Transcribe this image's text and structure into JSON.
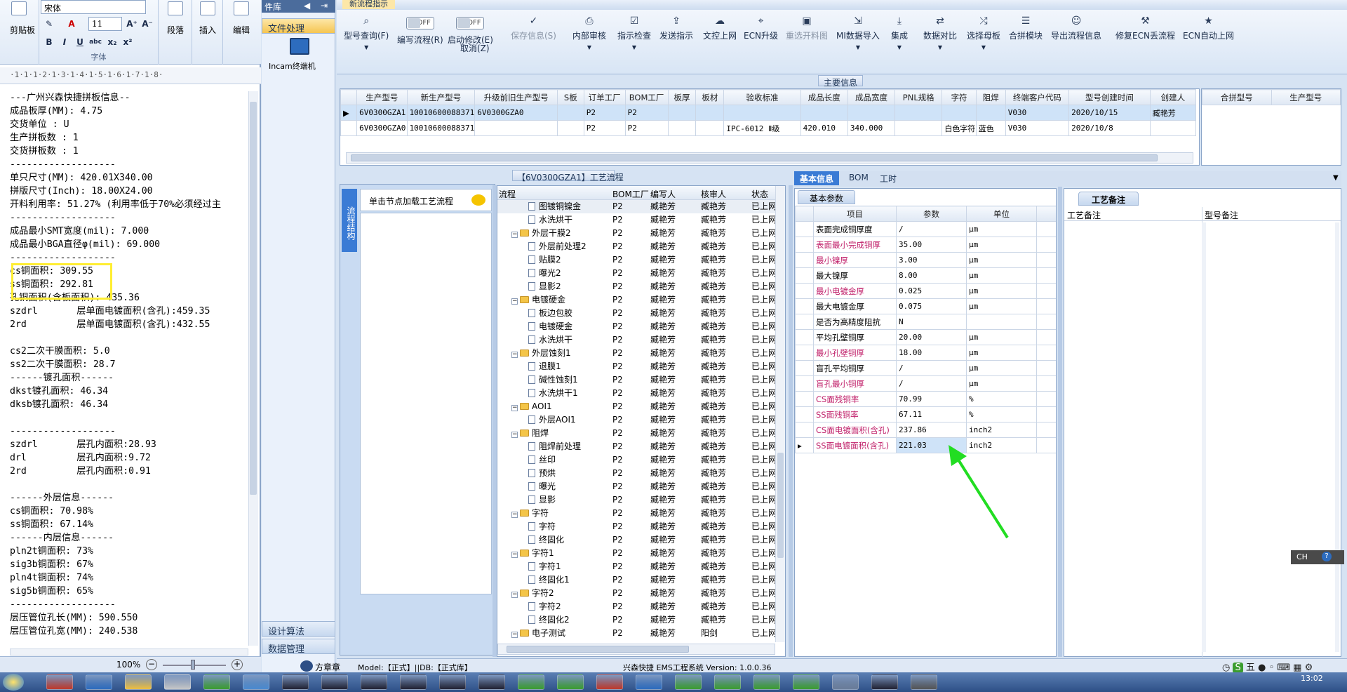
{
  "wordpad": {
    "clipboard_label": "剪贴板",
    "font_name": "宋体",
    "font_size": "11",
    "font_group_label": "字体",
    "paragraph_label": "段落",
    "insert_label": "插入",
    "edit_label": "编辑",
    "ruler": "·1·1·1·2·1·3·1·4·1·5·1·6·1·7·1·8·",
    "zoom": "100%",
    "lines": [
      "---广州兴森快捷拼板信息--",
      "成品板厚(MM): 4.75",
      "交货单位 : U",
      "生产拼板数 : 1",
      "交货拼板数 : 1",
      "-------------------",
      "单只尺寸(MM): 420.01X340.00",
      "拼版尺寸(Inch): 18.00X24.00",
      "开料利用率: 51.27% (利用率低于70%必须经过主",
      "-------------------",
      "成品最小SMT宽度(mil): 7.000",
      "成品最小BGA直径φ(mil): 69.000",
      "-------------------",
      "cs铜面积: 309.55",
      "ss铜面积: 292.81",
      "孔铜面积(含板面积): 435.36",
      "szdrl       层单面电镀面积(含孔):459.35",
      "2rd         层单面电镀面积(含孔):432.55",
      "",
      "cs2二次干膜面积: 5.0",
      "ss2二次干膜面积: 28.7",
      "------镀孔面积------",
      "dkst镀孔面积: 46.34",
      "dksb镀孔面积: 46.34",
      "",
      "-------------------",
      "szdrl       层孔内面积:28.93",
      "drl         层孔内面积:9.72",
      "2rd         层孔内面积:0.91",
      "",
      "------外层信息------",
      "cs铜面积: 70.98%",
      "ss铜面积: 67.14%",
      "------内层信息------",
      "pln2t铜面积: 73%",
      "sig3b铜面积: 67%",
      "pln4t铜面积: 74%",
      "sig5b铜面积: 65%",
      "-------------------",
      "层压管位孔长(MM): 590.550",
      "层压管位孔宽(MM): 240.538"
    ]
  },
  "nav": {
    "top_label": "件库",
    "file_process": "文件处理",
    "incam_label": "Incam终端机",
    "design_calc": "设计算法",
    "data_mgmt": "数据管理"
  },
  "main": {
    "window_title": "新流程指示",
    "toolbar": [
      {
        "label": "型号查询(F)",
        "icon": "search-icon"
      },
      {
        "label": "编写流程(R)",
        "icon": "toggle"
      },
      {
        "label": "启动修改(E)",
        "icon": "toggle"
      },
      {
        "label": "取消(Z)",
        "icon": ""
      },
      {
        "label": "保存信息(S)",
        "icon": "check-icon"
      },
      {
        "label": "内部审核",
        "icon": "print-icon"
      },
      {
        "label": "指示检查",
        "icon": "check-box-icon"
      },
      {
        "label": "发送指示",
        "icon": "upload-icon"
      },
      {
        "label": "文控上网",
        "icon": "cloud-icon"
      },
      {
        "label": "ECN升级",
        "icon": "binoculars-icon"
      },
      {
        "label": "重选开料图",
        "icon": "image-icon"
      },
      {
        "label": "MI数据导入",
        "icon": "import-icon"
      },
      {
        "label": "集成",
        "icon": "download-icon"
      },
      {
        "label": "数据对比",
        "icon": "compare-icon"
      },
      {
        "label": "选择母板",
        "icon": "shuffle-icon"
      },
      {
        "label": "合拼模块",
        "icon": "list-icon"
      },
      {
        "label": "导出流程信息",
        "icon": "smile-icon"
      },
      {
        "label": "修复ECN丢流程",
        "icon": "wrench-icon"
      },
      {
        "label": "ECN自动上网",
        "icon": "star-icon"
      }
    ],
    "toggle_off": "OFF",
    "main_info_title": "主要信息",
    "main_table": {
      "headers": [
        "生产型号",
        "新生产型号",
        "升级前旧生产型号",
        "S板",
        "订单工厂",
        "BOM工厂",
        "板厚",
        "板材",
        "验收标准",
        "成品长度",
        "成品宽度",
        "PNL规格",
        "字符",
        "阻焊",
        "终端客户代码",
        "型号创建时间",
        "创建人"
      ],
      "rows": [
        [
          "6V0300GZA1",
          "10010600088371",
          "6V0300GZA0",
          "",
          "P2",
          "P2",
          "",
          "",
          "",
          "",
          "",
          "",
          "",
          "",
          "V030",
          "2020/10/15",
          "臧艳芳"
        ],
        [
          "6V0300GZA0",
          "10010600088371",
          "",
          "",
          "P2",
          "P2",
          "",
          "",
          "IPC-6012 Ⅱ级",
          "420.010",
          "340.000",
          "",
          "白色字符",
          "蓝色",
          "V030",
          "2020/10/8",
          ""
        ]
      ]
    },
    "right_table_headers": [
      "合拼型号",
      "生产型号"
    ],
    "flow_title": "【6V0300GZA1】工艺流程",
    "side_tab": "流程结构",
    "load_hint": "单击节点加载工艺流程",
    "flow_headers": [
      "流程",
      "BOM工厂",
      "编写人",
      "核审人",
      "状态"
    ],
    "flow_rows": [
      {
        "level": 2,
        "type": "doc",
        "name": "图镀铜镍金",
        "bom": "P2",
        "writer": "臧艳芳",
        "reviewer": "臧艳芳",
        "status": "已上网"
      },
      {
        "level": 2,
        "type": "doc",
        "name": "水洗烘干",
        "bom": "P2",
        "writer": "臧艳芳",
        "reviewer": "臧艳芳",
        "status": "已上网"
      },
      {
        "level": 1,
        "type": "folder",
        "name": "外层干膜2",
        "bom": "P2",
        "writer": "臧艳芳",
        "reviewer": "臧艳芳",
        "status": "已上网"
      },
      {
        "level": 2,
        "type": "doc",
        "name": "外层前处理2",
        "bom": "P2",
        "writer": "臧艳芳",
        "reviewer": "臧艳芳",
        "status": "已上网"
      },
      {
        "level": 2,
        "type": "doc",
        "name": "贴膜2",
        "bom": "P2",
        "writer": "臧艳芳",
        "reviewer": "臧艳芳",
        "status": "已上网"
      },
      {
        "level": 2,
        "type": "doc",
        "name": "曝光2",
        "bom": "P2",
        "writer": "臧艳芳",
        "reviewer": "臧艳芳",
        "status": "已上网"
      },
      {
        "level": 2,
        "type": "doc",
        "name": "显影2",
        "bom": "P2",
        "writer": "臧艳芳",
        "reviewer": "臧艳芳",
        "status": "已上网"
      },
      {
        "level": 1,
        "type": "folder",
        "name": "电镀硬金",
        "bom": "P2",
        "writer": "臧艳芳",
        "reviewer": "臧艳芳",
        "status": "已上网"
      },
      {
        "level": 2,
        "type": "doc",
        "name": "板边包胶",
        "bom": "P2",
        "writer": "臧艳芳",
        "reviewer": "臧艳芳",
        "status": "已上网"
      },
      {
        "level": 2,
        "type": "doc",
        "name": "电镀硬金",
        "bom": "P2",
        "writer": "臧艳芳",
        "reviewer": "臧艳芳",
        "status": "已上网"
      },
      {
        "level": 2,
        "type": "doc",
        "name": "水洗烘干",
        "bom": "P2",
        "writer": "臧艳芳",
        "reviewer": "臧艳芳",
        "status": "已上网"
      },
      {
        "level": 1,
        "type": "folder",
        "name": "外层蚀刻1",
        "bom": "P2",
        "writer": "臧艳芳",
        "reviewer": "臧艳芳",
        "status": "已上网"
      },
      {
        "level": 2,
        "type": "doc",
        "name": "退膜1",
        "bom": "P2",
        "writer": "臧艳芳",
        "reviewer": "臧艳芳",
        "status": "已上网"
      },
      {
        "level": 2,
        "type": "doc",
        "name": "碱性蚀刻1",
        "bom": "P2",
        "writer": "臧艳芳",
        "reviewer": "臧艳芳",
        "status": "已上网"
      },
      {
        "level": 2,
        "type": "doc",
        "name": "水洗烘干1",
        "bom": "P2",
        "writer": "臧艳芳",
        "reviewer": "臧艳芳",
        "status": "已上网"
      },
      {
        "level": 1,
        "type": "folder",
        "name": "AOI1",
        "bom": "P2",
        "writer": "臧艳芳",
        "reviewer": "臧艳芳",
        "status": "已上网"
      },
      {
        "level": 2,
        "type": "doc",
        "name": "外层AOI1",
        "bom": "P2",
        "writer": "臧艳芳",
        "reviewer": "臧艳芳",
        "status": "已上网"
      },
      {
        "level": 1,
        "type": "folder",
        "name": "阻焊",
        "bom": "P2",
        "writer": "臧艳芳",
        "reviewer": "臧艳芳",
        "status": "已上网"
      },
      {
        "level": 2,
        "type": "doc",
        "name": "阻焊前处理",
        "bom": "P2",
        "writer": "臧艳芳",
        "reviewer": "臧艳芳",
        "status": "已上网"
      },
      {
        "level": 2,
        "type": "doc",
        "name": "丝印",
        "bom": "P2",
        "writer": "臧艳芳",
        "reviewer": "臧艳芳",
        "status": "已上网"
      },
      {
        "level": 2,
        "type": "doc",
        "name": "预烘",
        "bom": "P2",
        "writer": "臧艳芳",
        "reviewer": "臧艳芳",
        "status": "已上网"
      },
      {
        "level": 2,
        "type": "doc",
        "name": "曝光",
        "bom": "P2",
        "writer": "臧艳芳",
        "reviewer": "臧艳芳",
        "status": "已上网"
      },
      {
        "level": 2,
        "type": "doc",
        "name": "显影",
        "bom": "P2",
        "writer": "臧艳芳",
        "reviewer": "臧艳芳",
        "status": "已上网"
      },
      {
        "level": 1,
        "type": "folder",
        "name": "字符",
        "bom": "P2",
        "writer": "臧艳芳",
        "reviewer": "臧艳芳",
        "status": "已上网"
      },
      {
        "level": 2,
        "type": "doc",
        "name": "字符",
        "bom": "P2",
        "writer": "臧艳芳",
        "reviewer": "臧艳芳",
        "status": "已上网"
      },
      {
        "level": 2,
        "type": "doc",
        "name": "终固化",
        "bom": "P2",
        "writer": "臧艳芳",
        "reviewer": "臧艳芳",
        "status": "已上网"
      },
      {
        "level": 1,
        "type": "folder",
        "name": "字符1",
        "bom": "P2",
        "writer": "臧艳芳",
        "reviewer": "臧艳芳",
        "status": "已上网"
      },
      {
        "level": 2,
        "type": "doc",
        "name": "字符1",
        "bom": "P2",
        "writer": "臧艳芳",
        "reviewer": "臧艳芳",
        "status": "已上网"
      },
      {
        "level": 2,
        "type": "doc",
        "name": "终固化1",
        "bom": "P2",
        "writer": "臧艳芳",
        "reviewer": "臧艳芳",
        "status": "已上网"
      },
      {
        "level": 1,
        "type": "folder",
        "name": "字符2",
        "bom": "P2",
        "writer": "臧艳芳",
        "reviewer": "臧艳芳",
        "status": "已上网"
      },
      {
        "level": 2,
        "type": "doc",
        "name": "字符2",
        "bom": "P2",
        "writer": "臧艳芳",
        "reviewer": "臧艳芳",
        "status": "已上网"
      },
      {
        "level": 2,
        "type": "doc",
        "name": "终固化2",
        "bom": "P2",
        "writer": "臧艳芳",
        "reviewer": "臧艳芳",
        "status": "已上网"
      },
      {
        "level": 1,
        "type": "folder",
        "name": "电子测试",
        "bom": "P2",
        "writer": "臧艳芳",
        "reviewer": "阳剑",
        "status": "已上网"
      }
    ],
    "tabs": [
      "基本信息",
      "BOM",
      "工时"
    ],
    "subtab": "基本参数",
    "param_headers": [
      "项目",
      "参数",
      "单位"
    ],
    "params": [
      {
        "name": "表面完成铜厚度",
        "value": "/",
        "unit": "μm",
        "red": false
      },
      {
        "name": "表面最小完成铜厚",
        "value": "35.00",
        "unit": "μm",
        "red": true
      },
      {
        "name": "最小镍厚",
        "value": "3.00",
        "unit": "μm",
        "red": true
      },
      {
        "name": "最大镍厚",
        "value": "8.00",
        "unit": "μm",
        "red": false
      },
      {
        "name": "最小电镀金厚",
        "value": "0.025",
        "unit": "μm",
        "red": true
      },
      {
        "name": "最大电镀金厚",
        "value": "0.075",
        "unit": "μm",
        "red": false
      },
      {
        "name": "是否为高精度阻抗",
        "value": "N",
        "unit": "",
        "red": false
      },
      {
        "name": "平均孔壁铜厚",
        "value": "20.00",
        "unit": "μm",
        "red": false
      },
      {
        "name": "最小孔壁铜厚",
        "value": "18.00",
        "unit": "μm",
        "red": true
      },
      {
        "name": "盲孔平均铜厚",
        "value": "/",
        "unit": "μm",
        "red": false
      },
      {
        "name": "盲孔最小铜厚",
        "value": "/",
        "unit": "μm",
        "red": true
      },
      {
        "name": "CS面残铜率",
        "value": "70.99",
        "unit": "%",
        "red": true
      },
      {
        "name": "SS面残铜率",
        "value": "67.11",
        "unit": "%",
        "red": true
      },
      {
        "name": "CS面电镀面积(含孔)",
        "value": "237.86",
        "unit": "inch2",
        "red": true
      },
      {
        "name": "SS面电镀面积(含孔)",
        "value": "221.03",
        "unit": "inch2",
        "red": true
      }
    ],
    "remarks_title": "工艺备注",
    "remark_headers": [
      "工艺备注",
      "型号备注"
    ],
    "ime": "CH",
    "status": {
      "user": "方章章",
      "model": "Model:【正式】||DB:【正式库】",
      "system": "兴森快捷 EMS工程系统 Version: 1.0.0.36"
    },
    "clock": "13:02"
  },
  "colors": {
    "accent": "#3a7bd5",
    "arrow": "#22dd22",
    "highlight": "#ffee33",
    "red_param": "#c0206a"
  }
}
